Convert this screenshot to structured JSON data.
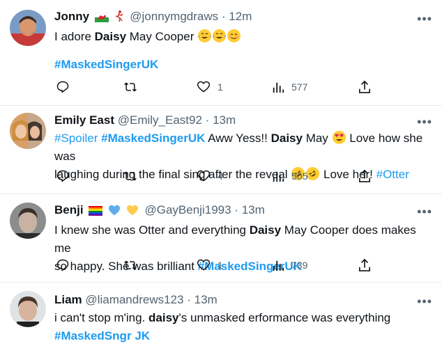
{
  "tweets": [
    {
      "name": "Jonny",
      "handle": "@jonnymgdraws",
      "time": "12m",
      "text_parts": {
        "a": "I adore ",
        "b": "Daisy",
        "c": " May Cooper"
      },
      "hashtag": "#MaskedSingerUK",
      "emojis": [
        "tears-of-joy",
        "tears-of-joy",
        "smiling-face"
      ],
      "replies": "",
      "retweets": "",
      "likes": "1",
      "views": "577"
    },
    {
      "name": "Emily East",
      "handle": "@Emily_East92",
      "time": "13m",
      "text_parts": {
        "tag1": "#Spoiler",
        "tag2": "#MaskedSingerUK",
        "a": " Aww Yess!! ",
        "b": "Daisy",
        "c": " May ",
        "d": " Love how she was",
        "e": "laughing during the final sing after the reveal ",
        "f": " Love her! ",
        "tag3": "#Otter"
      },
      "likes": "4",
      "views": "505"
    },
    {
      "name": "Benji",
      "handle": "@GayBenji1993",
      "time": "13m",
      "text_parts": {
        "a": "I knew she was Otter and everything ",
        "b": "Daisy",
        "c": " May Cooper does makes me",
        "d": "so happy. She was brilliant ",
        "tag": "#MaskedSingerUK"
      },
      "likes": "1",
      "views": "739"
    },
    {
      "name": "Liam",
      "handle": "@liamandrews123",
      "time": "13m",
      "text_parts": {
        "a": "i can't stop ",
        "a2": "m",
        "a3": "'ing. ",
        "b": "daisy",
        "c": "'s unmasked ",
        "c2": "er",
        "c3": "formance was everything"
      },
      "tag_a": "#MaskedS",
      "tag_b": "ng",
      "tag_c": "r",
      "tag_d": "JK"
    }
  ],
  "separator": "·",
  "more_label": "•••",
  "colors": {
    "link": "#1d9bf0",
    "muted": "#536471",
    "text": "#0f1419",
    "divider": "#e6ecf0"
  },
  "icons": [
    "reply-icon",
    "retweet-icon",
    "like-icon",
    "views-icon",
    "share-icon",
    "more-icon"
  ]
}
